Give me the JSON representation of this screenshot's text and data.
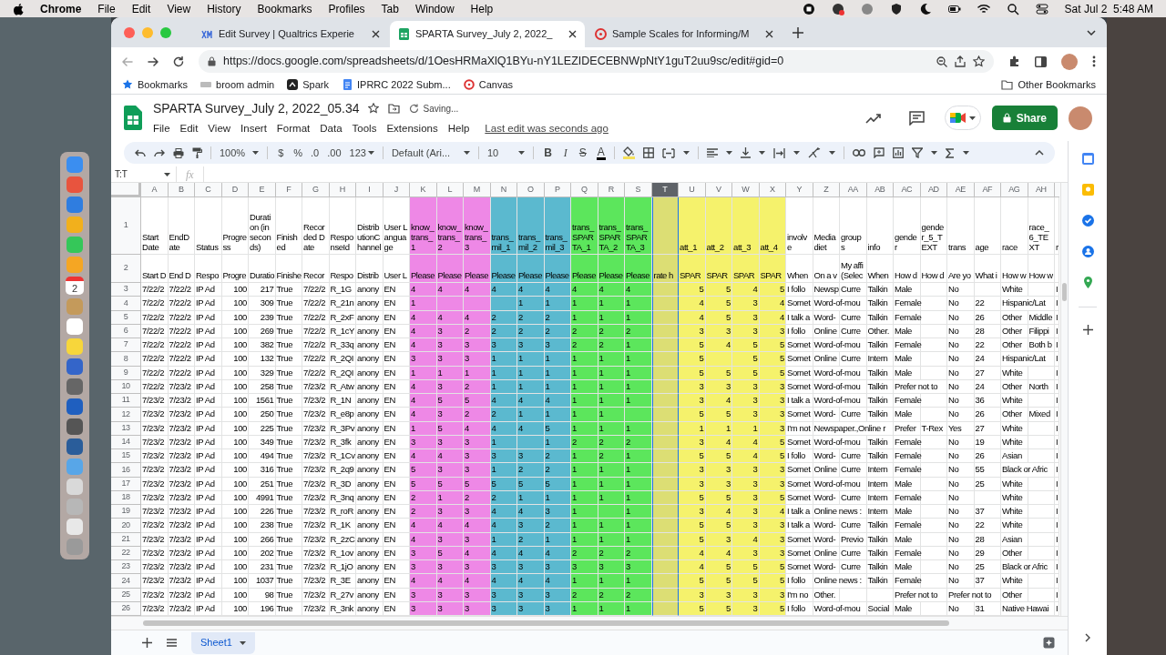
{
  "menu_bar": {
    "app": "Chrome",
    "items": [
      "File",
      "Edit",
      "View",
      "History",
      "Bookmarks",
      "Profiles",
      "Tab",
      "Window",
      "Help"
    ],
    "clock": "Sat Jul 2  5:48 AM"
  },
  "dock": {
    "calendar_day": "2"
  },
  "browser": {
    "tabs": [
      {
        "title": "Edit Survey | Qualtrics Experie",
        "selected": false
      },
      {
        "title": "SPARTA Survey_July 2, 2022_",
        "selected": true
      },
      {
        "title": "Sample Scales for Informing/M",
        "selected": false
      }
    ],
    "url": "https://docs.google.com/spreadsheets/d/1OesHRMaXlQ1BYu-nY1LEZIDECEBNWpNtY1guT2uu9sc/edit#gid=0",
    "bookmarks": [
      "Bookmarks",
      "broom admin",
      "Spark",
      "IPRRC 2022 Subm...",
      "Canvas"
    ],
    "other_bookmarks": "Other Bookmarks"
  },
  "doc": {
    "title": "SPARTA Survey_July 2, 2022_05.34",
    "save_status": "Saving...",
    "menu": [
      "File",
      "Edit",
      "View",
      "Insert",
      "Format",
      "Data",
      "Tools",
      "Extensions",
      "Help"
    ],
    "last_edit": "Last edit was seconds ago",
    "share": "Share"
  },
  "toolbar": {
    "zoom": "100%",
    "currency": "$",
    "percent": "%",
    "decrease_decimals": ".0",
    "increase_decimals": ".00",
    "more_formats": "123",
    "font": "Default (Ari...",
    "font_size": "10",
    "bold": "B",
    "italic": "I",
    "strikethrough": "S",
    "text_color": "A"
  },
  "formula_bar": {
    "name_box": "T:T",
    "fx": "fx"
  },
  "sheet": {
    "header_row_numbers": [
      "1",
      "2"
    ],
    "columns": [
      {
        "letter": "A",
        "header": "Start Date",
        "label": "Start D",
        "selected": false
      },
      {
        "letter": "B",
        "header": "EndDate",
        "label": "End D",
        "selected": false
      },
      {
        "letter": "C",
        "header": "Status",
        "label": "Respo",
        "selected": false
      },
      {
        "letter": "D",
        "header": "Progress",
        "label": "Progre",
        "selected": false
      },
      {
        "letter": "E",
        "header": "Duration (in seconds)",
        "label": "Duratio",
        "selected": false
      },
      {
        "letter": "F",
        "header": "Finished",
        "label": "Finishe",
        "selected": false
      },
      {
        "letter": "G",
        "header": "Recorded Date",
        "label": "Recor",
        "selected": false
      },
      {
        "letter": "H",
        "header": "ResponseId",
        "label": "Respo",
        "selected": false
      },
      {
        "letter": "I",
        "header": "DistributionChannel",
        "label": "Distrib",
        "selected": false
      },
      {
        "letter": "J",
        "header": "User Language",
        "label": "User L",
        "selected": false
      },
      {
        "letter": "K",
        "header": "know_trans_1",
        "label": "Please",
        "selected": false,
        "color": "#ee88e6"
      },
      {
        "letter": "L",
        "header": "know_trans_2",
        "label": "Please",
        "selected": false,
        "color": "#ee88e6"
      },
      {
        "letter": "M",
        "header": "know_trans_3",
        "label": "Please",
        "selected": false,
        "color": "#ee88e6"
      },
      {
        "letter": "N",
        "header": "trans_mil_1",
        "label": "Please",
        "selected": false,
        "color": "#5bb9cf"
      },
      {
        "letter": "O",
        "header": "trans_mil_2",
        "label": "Please",
        "selected": false,
        "color": "#5bb9cf"
      },
      {
        "letter": "P",
        "header": "trans_mil_3",
        "label": "Please",
        "selected": false,
        "color": "#5bb9cf"
      },
      {
        "letter": "Q",
        "header": "trans_SPARTA_1",
        "label": "Please",
        "selected": false,
        "color": "#5ce65c"
      },
      {
        "letter": "R",
        "header": "trans_SPARTA_2",
        "label": "Please",
        "selected": false,
        "color": "#5ce65c"
      },
      {
        "letter": "S",
        "header": "trans_SPARTA_3",
        "label": "Please",
        "selected": false,
        "color": "#5ce65c"
      },
      {
        "letter": "T",
        "label": "rate h",
        "selected": true,
        "color": "#dcde74"
      },
      {
        "letter": "U",
        "header": "att_1",
        "label": "SPAR",
        "selected": false,
        "color": "#f5f26c"
      },
      {
        "letter": "V",
        "header": "att_2",
        "label": "SPAR",
        "selected": false,
        "color": "#f5f26c"
      },
      {
        "letter": "W",
        "header": "att_3",
        "label": "SPAR",
        "selected": false,
        "color": "#f5f26c"
      },
      {
        "letter": "X",
        "header": "att_4",
        "label": "SPAR",
        "selected": false,
        "color": "#f5f26c"
      },
      {
        "letter": "Y",
        "header": "involve",
        "label": "When",
        "selected": false
      },
      {
        "letter": "Z",
        "header": "Media diet",
        "label": "On a v",
        "selected": false
      },
      {
        "letter": "AA",
        "header": "groups",
        "label": "My affi (Selec",
        "selected": false
      },
      {
        "letter": "AB",
        "header": "info",
        "label": "When",
        "selected": false
      },
      {
        "letter": "AC",
        "header": "gender",
        "label": "How d",
        "selected": false
      },
      {
        "letter": "AD",
        "header": "gender_5_TEXT",
        "label": "How d",
        "selected": false
      },
      {
        "letter": "AE",
        "header": "trans",
        "label": "Are yo",
        "selected": false
      },
      {
        "letter": "AF",
        "header": "age",
        "label": "What i",
        "selected": false
      },
      {
        "letter": "AG",
        "header": "race",
        "label": "How w",
        "selected": false
      },
      {
        "letter": "AH",
        "header": "race_6_TEXT",
        "label": "How w",
        "selected": false
      },
      {
        "header": "r",
        "selected": false
      }
    ],
    "rows": [
      {
        "number": "3",
        "cells": [
          "7/22/2",
          "7/22/2",
          "IP Ad",
          "100",
          "217",
          "True",
          "7/22/2",
          "R_1G",
          "anony",
          "EN",
          "4",
          "4",
          "4",
          "4",
          "4",
          "4",
          "4",
          "4",
          "4",
          "",
          "5",
          "5",
          "4",
          "5",
          "I follo",
          "Newsp",
          "Curre",
          "Talkin",
          "Male",
          "",
          "No",
          "",
          "White",
          "",
          "I"
        ]
      },
      {
        "number": "4",
        "cells": [
          "7/22/2",
          "7/22/2",
          "IP Ad",
          "100",
          "309",
          "True",
          "7/22/2",
          "R_21n",
          "anony",
          "EN",
          "1",
          "",
          "",
          "",
          "1",
          "1",
          "1",
          "1",
          "1",
          "",
          "4",
          "5",
          "3",
          "4",
          "Somet",
          "Word-of-mou",
          "",
          "Talkin",
          "Female",
          "",
          "No",
          "22",
          "Hispanic/Lat",
          "",
          "I"
        ]
      },
      {
        "number": "5",
        "cells": [
          "7/22/2",
          "7/22/2",
          "IP Ad",
          "100",
          "239",
          "True",
          "7/22/2",
          "R_2xF",
          "anony",
          "EN",
          "4",
          "4",
          "4",
          "2",
          "2",
          "2",
          "1",
          "1",
          "1",
          "",
          "4",
          "5",
          "3",
          "4",
          "I talk a",
          "Word-",
          "Curre",
          "Talkin",
          "Female",
          "",
          "No",
          "26",
          "Other",
          "Middle",
          "I"
        ]
      },
      {
        "number": "6",
        "cells": [
          "7/22/2",
          "7/22/2",
          "IP Ad",
          "100",
          "269",
          "True",
          "7/22/2",
          "R_1cY",
          "anony",
          "EN",
          "4",
          "3",
          "2",
          "2",
          "2",
          "2",
          "2",
          "2",
          "2",
          "",
          "3",
          "3",
          "3",
          "3",
          "I follo",
          "Online",
          "Curre",
          "Other.",
          "Male",
          "",
          "No",
          "28",
          "Other",
          "Filippi",
          "I"
        ]
      },
      {
        "number": "7",
        "cells": [
          "7/22/2",
          "7/22/2",
          "IP Ad",
          "100",
          "382",
          "True",
          "7/22/2",
          "R_33q",
          "anony",
          "EN",
          "4",
          "3",
          "3",
          "3",
          "3",
          "3",
          "2",
          "2",
          "1",
          "",
          "5",
          "4",
          "5",
          "5",
          "Somet",
          "Word-of-mou",
          "",
          "Talkin",
          "Female",
          "",
          "No",
          "22",
          "Other",
          "Both b",
          "I"
        ]
      },
      {
        "number": "8",
        "cells": [
          "7/22/2",
          "7/22/2",
          "IP Ad",
          "100",
          "132",
          "True",
          "7/22/2",
          "R_2QI",
          "anony",
          "EN",
          "3",
          "3",
          "3",
          "1",
          "1",
          "1",
          "1",
          "1",
          "1",
          "",
          "5",
          "",
          "5",
          "5",
          "Somet",
          "Online",
          "Curre",
          "Intern",
          "Male",
          "",
          "No",
          "24",
          "Hispanic/Lat",
          "",
          "I"
        ]
      },
      {
        "number": "9",
        "cells": [
          "7/22/2",
          "7/22/2",
          "IP Ad",
          "100",
          "329",
          "True",
          "7/22/2",
          "R_2QI",
          "anony",
          "EN",
          "1",
          "1",
          "1",
          "1",
          "1",
          "1",
          "1",
          "1",
          "1",
          "",
          "5",
          "5",
          "5",
          "5",
          "Somet",
          "Word-of-mou",
          "",
          "Talkin",
          "Male",
          "",
          "No",
          "27",
          "White",
          "",
          "I"
        ]
      },
      {
        "number": "10",
        "cells": [
          "7/22/2",
          "7/23/2",
          "IP Ad",
          "100",
          "258",
          "True",
          "7/23/2",
          "R_Atw",
          "anony",
          "EN",
          "4",
          "3",
          "2",
          "1",
          "1",
          "1",
          "1",
          "1",
          "1",
          "",
          "3",
          "3",
          "3",
          "3",
          "Somet",
          "Word-of-mou",
          "",
          "Talkin",
          "Prefer not to",
          "",
          "No",
          "24",
          "Other",
          "North",
          "I"
        ]
      },
      {
        "number": "11",
        "cells": [
          "7/23/2",
          "7/23/2",
          "IP Ad",
          "100",
          "1561",
          "True",
          "7/23/2",
          "R_1N",
          "anony",
          "EN",
          "4",
          "5",
          "5",
          "4",
          "4",
          "4",
          "1",
          "1",
          "1",
          "",
          "3",
          "4",
          "3",
          "3",
          "I talk a",
          "Word-of-mou",
          "",
          "Talkin",
          "Female",
          "",
          "No",
          "36",
          "White",
          "",
          "I"
        ]
      },
      {
        "number": "12",
        "cells": [
          "7/23/2",
          "7/23/2",
          "IP Ad",
          "100",
          "250",
          "True",
          "7/23/2",
          "R_e8p",
          "anony",
          "EN",
          "4",
          "3",
          "2",
          "2",
          "1",
          "1",
          "1",
          "1",
          "",
          "",
          "5",
          "5",
          "3",
          "3",
          "Somet",
          "Word-",
          "Curre",
          "Talkin",
          "Male",
          "",
          "No",
          "26",
          "Other",
          "Mixed",
          "I"
        ]
      },
      {
        "number": "13",
        "cells": [
          "7/23/2",
          "7/23/2",
          "IP Ad",
          "100",
          "225",
          "True",
          "7/23/2",
          "R_3Pv",
          "anony",
          "EN",
          "1",
          "5",
          "4",
          "4",
          "4",
          "5",
          "1",
          "1",
          "1",
          "",
          "1",
          "1",
          "1",
          "3",
          "I'm not",
          "Newspaper.,Online r",
          "",
          "",
          "Prefer",
          "T-Rex",
          "Yes",
          "27",
          "White",
          "",
          "I"
        ]
      },
      {
        "number": "14",
        "cells": [
          "7/23/2",
          "7/23/2",
          "IP Ad",
          "100",
          "349",
          "True",
          "7/23/2",
          "R_3fk",
          "anony",
          "EN",
          "3",
          "3",
          "3",
          "1",
          "",
          "1",
          "2",
          "2",
          "2",
          "",
          "3",
          "4",
          "4",
          "5",
          "Somet",
          "Word-of-mou",
          "",
          "Talkin",
          "Female",
          "",
          "No",
          "19",
          "White",
          "",
          "I"
        ]
      },
      {
        "number": "15",
        "cells": [
          "7/23/2",
          "7/23/2",
          "IP Ad",
          "100",
          "494",
          "True",
          "7/23/2",
          "R_1Cv",
          "anony",
          "EN",
          "4",
          "4",
          "3",
          "3",
          "3",
          "2",
          "1",
          "2",
          "1",
          "",
          "5",
          "5",
          "4",
          "5",
          "I follo",
          "Word-",
          "Curre",
          "Talkin",
          "Female",
          "",
          "No",
          "26",
          "Asian",
          "",
          "I"
        ]
      },
      {
        "number": "16",
        "cells": [
          "7/23/2",
          "7/23/2",
          "IP Ad",
          "100",
          "316",
          "True",
          "7/23/2",
          "R_2q9",
          "anony",
          "EN",
          "5",
          "3",
          "3",
          "1",
          "2",
          "2",
          "1",
          "1",
          "1",
          "",
          "3",
          "3",
          "3",
          "3",
          "Somet",
          "Online",
          "Curre",
          "Intern",
          "Female",
          "",
          "No",
          "55",
          "Black or Afric",
          "",
          "I"
        ]
      },
      {
        "number": "17",
        "cells": [
          "7/23/2",
          "7/23/2",
          "IP Ad",
          "100",
          "251",
          "True",
          "7/23/2",
          "R_3D",
          "anony",
          "EN",
          "5",
          "5",
          "5",
          "5",
          "5",
          "5",
          "1",
          "1",
          "1",
          "",
          "3",
          "3",
          "3",
          "3",
          "Somet",
          "Word-of-mou",
          "",
          "Intern",
          "Male",
          "",
          "No",
          "25",
          "White",
          "",
          "I"
        ]
      },
      {
        "number": "18",
        "cells": [
          "7/23/2",
          "7/23/2",
          "IP Ad",
          "100",
          "4991",
          "True",
          "7/23/2",
          "R_3nq",
          "anony",
          "EN",
          "2",
          "1",
          "2",
          "2",
          "1",
          "1",
          "1",
          "1",
          "1",
          "",
          "5",
          "5",
          "3",
          "5",
          "Somet",
          "Word-",
          "Curre",
          "Intern",
          "Female",
          "",
          "No",
          "",
          "White",
          "",
          "I"
        ]
      },
      {
        "number": "19",
        "cells": [
          "7/23/2",
          "7/23/2",
          "IP Ad",
          "100",
          "226",
          "True",
          "7/23/2",
          "R_roR",
          "anony",
          "EN",
          "2",
          "3",
          "3",
          "4",
          "4",
          "3",
          "1",
          "",
          "1",
          "",
          "3",
          "4",
          "3",
          "4",
          "I talk a",
          "Online news :",
          "",
          "Intern",
          "Male",
          "",
          "No",
          "37",
          "White",
          "",
          "I"
        ]
      },
      {
        "number": "20",
        "cells": [
          "7/23/2",
          "7/23/2",
          "IP Ad",
          "100",
          "238",
          "True",
          "7/23/2",
          "R_1K",
          "anony",
          "EN",
          "4",
          "4",
          "4",
          "4",
          "3",
          "2",
          "1",
          "1",
          "1",
          "",
          "5",
          "5",
          "3",
          "3",
          "I talk a",
          "Word-",
          "Curre",
          "Talkin",
          "Female",
          "",
          "No",
          "22",
          "White",
          "",
          "I"
        ]
      },
      {
        "number": "21",
        "cells": [
          "7/23/2",
          "7/23/2",
          "IP Ad",
          "100",
          "266",
          "True",
          "7/23/2",
          "R_2zC",
          "anony",
          "EN",
          "4",
          "3",
          "3",
          "1",
          "2",
          "1",
          "1",
          "1",
          "1",
          "",
          "5",
          "3",
          "4",
          "3",
          "Somet",
          "Word-",
          "Previo",
          "Talkin",
          "Male",
          "",
          "No",
          "28",
          "Asian",
          "",
          "I"
        ]
      },
      {
        "number": "22",
        "cells": [
          "7/23/2",
          "7/23/2",
          "IP Ad",
          "100",
          "202",
          "True",
          "7/23/2",
          "R_1ov",
          "anony",
          "EN",
          "3",
          "5",
          "4",
          "4",
          "4",
          "4",
          "2",
          "2",
          "2",
          "",
          "4",
          "4",
          "3",
          "3",
          "Somet",
          "Online",
          "Curre",
          "Talkin",
          "Female",
          "",
          "No",
          "29",
          "Other",
          "",
          "I"
        ]
      },
      {
        "number": "23",
        "cells": [
          "7/23/2",
          "7/23/2",
          "IP Ad",
          "100",
          "231",
          "True",
          "7/23/2",
          "R_1jO",
          "anony",
          "EN",
          "3",
          "3",
          "3",
          "3",
          "3",
          "3",
          "3",
          "3",
          "3",
          "",
          "4",
          "5",
          "5",
          "5",
          "Somet",
          "Word-",
          "Curre",
          "Talkin",
          "Male",
          "",
          "No",
          "25",
          "Black or Afric",
          "",
          "I"
        ]
      },
      {
        "number": "24",
        "cells": [
          "7/23/2",
          "7/23/2",
          "IP Ad",
          "100",
          "1037",
          "True",
          "7/23/2",
          "R_3E",
          "anony",
          "EN",
          "4",
          "4",
          "4",
          "4",
          "4",
          "4",
          "1",
          "1",
          "1",
          "",
          "5",
          "5",
          "5",
          "5",
          "I follo",
          "Online news :",
          "",
          "Talkin",
          "Female",
          "",
          "No",
          "37",
          "White",
          "",
          "I"
        ]
      },
      {
        "number": "25",
        "cells": [
          "7/23/2",
          "7/23/2",
          "IP Ad",
          "100",
          "98",
          "True",
          "7/23/2",
          "R_27v",
          "anony",
          "EN",
          "3",
          "3",
          "3",
          "3",
          "3",
          "3",
          "2",
          "2",
          "2",
          "",
          "3",
          "3",
          "3",
          "3",
          "I'm no",
          "Other.",
          "",
          "",
          "Prefer not to",
          "",
          "Prefer not to",
          "",
          "Other",
          "",
          "I"
        ]
      },
      {
        "number": "26",
        "cells": [
          "7/23/2",
          "7/23/2",
          "IP Ad",
          "100",
          "196",
          "True",
          "7/23/2",
          "R_3nk",
          "anony",
          "EN",
          "3",
          "3",
          "3",
          "3",
          "3",
          "3",
          "1",
          "1",
          "1",
          "",
          "5",
          "5",
          "3",
          "5",
          "I follo",
          "Word-of-mou",
          "",
          "Social",
          "Male",
          "",
          "No",
          "31",
          "Native Hawai",
          "",
          "I"
        ]
      }
    ]
  },
  "sheet_tabs": [
    {
      "name": "Sheet1",
      "selected": true
    }
  ]
}
